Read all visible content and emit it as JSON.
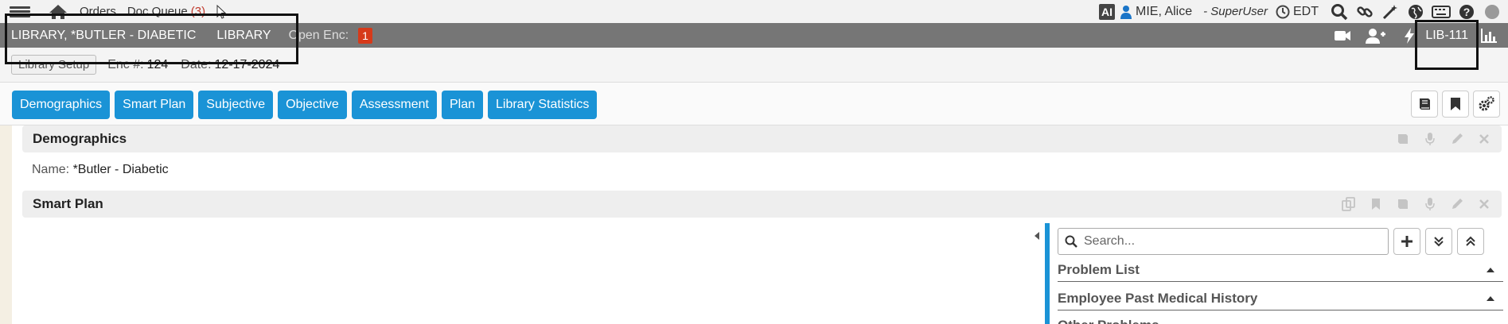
{
  "topbar": {
    "orders": "Orders",
    "doc_queue": "Doc Queue",
    "doc_queue_count": "(3)",
    "ai": "AI",
    "username": "MIE, Alice",
    "role": "- SuperUser",
    "timezone": "EDT"
  },
  "patient": {
    "name": "LIBRARY, *BUTLER - DIABETIC",
    "library": "LIBRARY",
    "open_enc_label": "Open Enc:",
    "open_enc_count": "1",
    "code": "LIB-111"
  },
  "encounter": {
    "setup_button": "Library Setup",
    "enc_label": "Enc #:",
    "enc_value": "124",
    "date_label": "Date:",
    "date_value": "12-17-2024"
  },
  "tabs": [
    "Demographics",
    "Smart Plan",
    "Subjective",
    "Objective",
    "Assessment",
    "Plan",
    "Library Statistics"
  ],
  "demographics": {
    "title": "Demographics",
    "name_label": "Name:",
    "name_value": "*Butler - Diabetic"
  },
  "smart_plan": {
    "title": "Smart Plan",
    "search_placeholder": "Search...",
    "items": [
      "Problem List",
      "Employee Past Medical History",
      "Other Problems"
    ]
  },
  "colors": {
    "accent": "#1a93d6",
    "patient_bar": "#767676",
    "badge": "#d63a1a"
  }
}
